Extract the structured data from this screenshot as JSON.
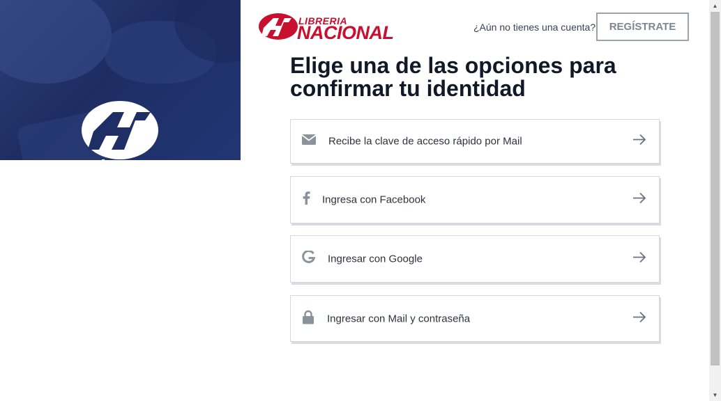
{
  "brand": {
    "line1": "LIBRERIA",
    "line2": "NACIONAL",
    "color": "#c8102e"
  },
  "header": {
    "no_account": "¿Aún no tienes una cuenta?",
    "register": "REGÍSTRATE"
  },
  "title": "Elige una de las opciones para confirmar tu identidad",
  "options": [
    {
      "label": "Recibe la clave de acceso rápido por Mail",
      "icon": "envelope-icon"
    },
    {
      "label": "Ingresa con Facebook",
      "icon": "facebook-icon"
    },
    {
      "label": "Ingresar con Google",
      "icon": "google-icon"
    },
    {
      "label": "Ingresar con Mail y contraseña",
      "icon": "lock-icon"
    }
  ],
  "colors": {
    "hero": "#1d2d63",
    "icon": "#8a929c",
    "border": "#d4d8de"
  }
}
